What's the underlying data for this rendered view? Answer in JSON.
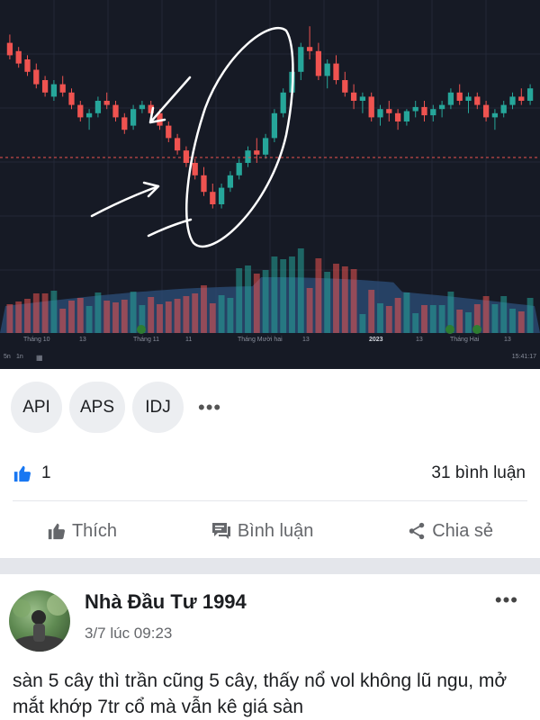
{
  "chart": {
    "x_labels": [
      "Tháng 10",
      "13",
      "Tháng 11",
      "11",
      "Tháng Mười hai",
      "13",
      "2023",
      "13",
      "Tháng Hai",
      "13"
    ],
    "bottom_left": [
      "5n",
      "1n"
    ],
    "timestamp": "15:41:17",
    "colors": {
      "up": "#26a69a",
      "down": "#ef5350",
      "bg": "#161a25",
      "ref_line": "#ef5350"
    }
  },
  "chart_data": {
    "type": "candlestick",
    "title": "",
    "xlabel": "",
    "ylabel": "",
    "grid": true,
    "legend": "none",
    "x": [
      "Tháng 10",
      "13",
      "Tháng 11",
      "11",
      "Tháng Mười hai",
      "13",
      "2023",
      "13",
      "Tháng Hai",
      "13"
    ],
    "ohlc_relative": [
      [
        88,
        92,
        80,
        82
      ],
      [
        84,
        86,
        76,
        78
      ],
      [
        80,
        82,
        72,
        74
      ],
      [
        75,
        78,
        66,
        68
      ],
      [
        70,
        72,
        62,
        64
      ],
      [
        62,
        70,
        60,
        68
      ],
      [
        68,
        72,
        62,
        64
      ],
      [
        64,
        66,
        56,
        58
      ],
      [
        58,
        60,
        50,
        52
      ],
      [
        52,
        56,
        46,
        54
      ],
      [
        54,
        62,
        52,
        60
      ],
      [
        60,
        64,
        56,
        58
      ],
      [
        58,
        60,
        50,
        52
      ],
      [
        52,
        54,
        44,
        46
      ],
      [
        48,
        58,
        46,
        56
      ],
      [
        56,
        60,
        54,
        58
      ],
      [
        58,
        60,
        52,
        54
      ],
      [
        54,
        56,
        46,
        48
      ],
      [
        48,
        50,
        40,
        42
      ],
      [
        42,
        44,
        34,
        36
      ],
      [
        36,
        38,
        28,
        30
      ],
      [
        30,
        32,
        22,
        24
      ],
      [
        24,
        28,
        14,
        16
      ],
      [
        16,
        20,
        8,
        10
      ],
      [
        10,
        20,
        8,
        18
      ],
      [
        18,
        26,
        16,
        24
      ],
      [
        24,
        32,
        22,
        30
      ],
      [
        30,
        38,
        28,
        36
      ],
      [
        36,
        42,
        30,
        34
      ],
      [
        34,
        44,
        32,
        42
      ],
      [
        42,
        56,
        40,
        54
      ],
      [
        54,
        66,
        52,
        64
      ],
      [
        64,
        76,
        62,
        74
      ],
      [
        74,
        88,
        70,
        86
      ],
      [
        86,
        96,
        80,
        84
      ],
      [
        84,
        88,
        70,
        72
      ],
      [
        72,
        80,
        66,
        78
      ],
      [
        78,
        82,
        68,
        70
      ],
      [
        70,
        74,
        62,
        64
      ],
      [
        64,
        68,
        56,
        60
      ],
      [
        60,
        64,
        54,
        62
      ],
      [
        62,
        64,
        50,
        52
      ],
      [
        52,
        58,
        48,
        56
      ],
      [
        56,
        60,
        50,
        54
      ],
      [
        54,
        56,
        46,
        50
      ],
      [
        50,
        56,
        48,
        55
      ],
      [
        55,
        60,
        52,
        57
      ],
      [
        57,
        60,
        50,
        53
      ],
      [
        53,
        58,
        50,
        56
      ],
      [
        56,
        60,
        52,
        58
      ],
      [
        58,
        66,
        56,
        64
      ],
      [
        64,
        68,
        58,
        60
      ],
      [
        60,
        64,
        54,
        62
      ],
      [
        62,
        64,
        56,
        58
      ],
      [
        58,
        60,
        50,
        52
      ],
      [
        52,
        56,
        46,
        54
      ],
      [
        54,
        60,
        52,
        58
      ],
      [
        58,
        64,
        56,
        62
      ],
      [
        62,
        66,
        58,
        60
      ],
      [
        60,
        68,
        58,
        66
      ]
    ]
  },
  "tags": [
    "API",
    "APS",
    "IDJ"
  ],
  "tags_more_icon": "more-horizontal-icon",
  "reactions": {
    "like_count": "1",
    "comments": "31 bình luận",
    "like_color": "#1877f2"
  },
  "actions": {
    "like": "Thích",
    "comment": "Bình luận",
    "share": "Chia sẻ"
  },
  "post": {
    "author": "Nhà Đầu Tư 1994",
    "time": "3/7 lúc 09:23",
    "text": "sàn 5 cây thì trần cũng 5 cây, thấy nổ vol không lũ ngu, mở mắt khớp 7tr cổ mà vẫn kê giá sàn"
  }
}
